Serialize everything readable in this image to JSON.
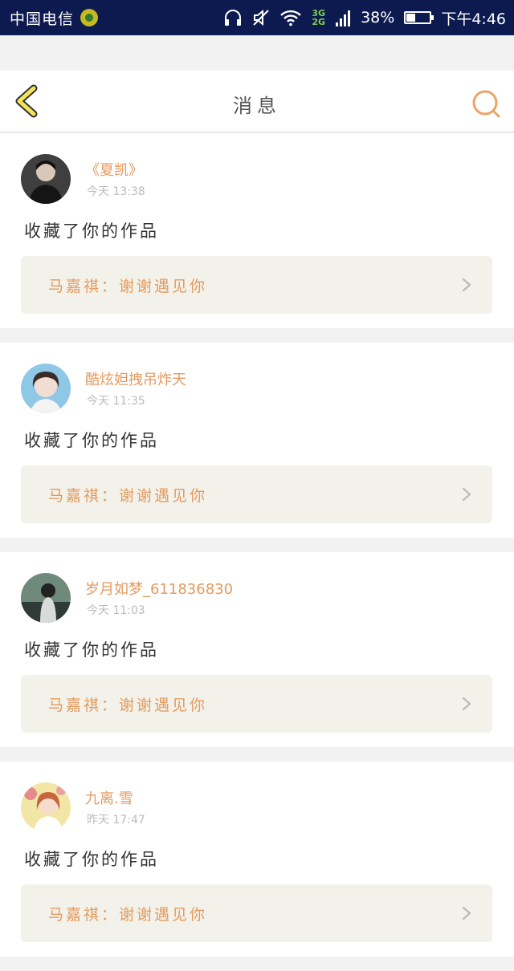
{
  "status_bar": {
    "carrier": "中国电信",
    "network_top": "3G",
    "network_bottom": "2G",
    "battery": "38%",
    "battery_level": 0.38,
    "time": "下午4:46"
  },
  "header": {
    "title": "消息",
    "back_icon": "chevron-left-icon",
    "search_icon": "search-icon",
    "accent": "#e59a5e"
  },
  "messages": [
    {
      "user": "《夏凯》",
      "time": "今天 13:38",
      "action": "收藏了你的作品",
      "reply": "马嘉祺：谢谢遇见你"
    },
    {
      "user": "酷炫妲拽吊炸天",
      "time": "今天 11:35",
      "action": "收藏了你的作品",
      "reply": "马嘉祺：谢谢遇见你"
    },
    {
      "user": "岁月如梦_611836830",
      "time": "今天 11:03",
      "action": "收藏了你的作品",
      "reply": "马嘉祺：谢谢遇见你"
    },
    {
      "user": "九离.雪",
      "time": "昨天 17:47",
      "action": "收藏了你的作品",
      "reply": "马嘉祺：谢谢遇见你"
    }
  ]
}
